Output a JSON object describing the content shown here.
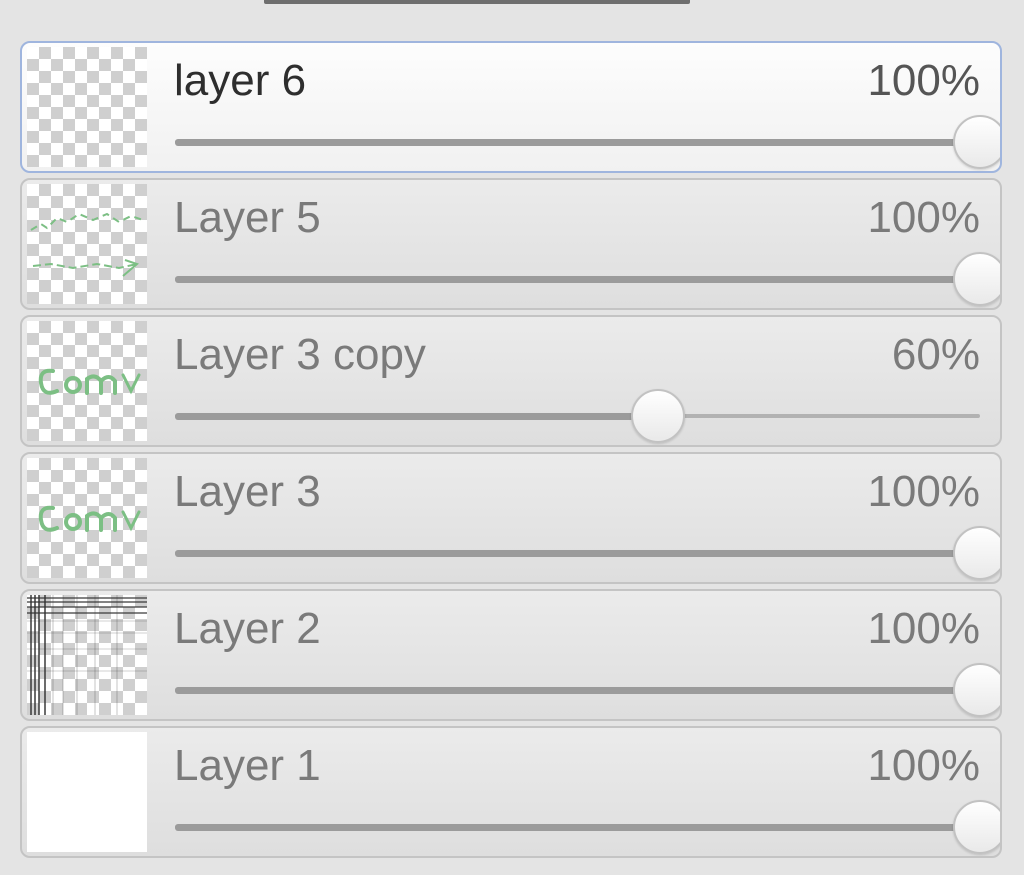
{
  "layers": [
    {
      "name": "layer 6",
      "opacity_text": "100%",
      "opacity": 1.0,
      "selected": true,
      "thumbnail": "transparent"
    },
    {
      "name": "Layer 5",
      "opacity_text": "100%",
      "opacity": 1.0,
      "selected": false,
      "thumbnail": "sketch-lines"
    },
    {
      "name": "Layer 3 copy",
      "opacity_text": "60%",
      "opacity": 0.6,
      "selected": false,
      "thumbnail": "green-lettering"
    },
    {
      "name": "Layer 3",
      "opacity_text": "100%",
      "opacity": 1.0,
      "selected": false,
      "thumbnail": "green-lettering"
    },
    {
      "name": "Layer 2",
      "opacity_text": "100%",
      "opacity": 1.0,
      "selected": false,
      "thumbnail": "grid-lines"
    },
    {
      "name": "Layer 1",
      "opacity_text": "100%",
      "opacity": 1.0,
      "selected": false,
      "thumbnail": "white"
    }
  ],
  "colors": {
    "selected_border": "#9fb5de",
    "thumbnail_art_green": "#7cbf84"
  }
}
